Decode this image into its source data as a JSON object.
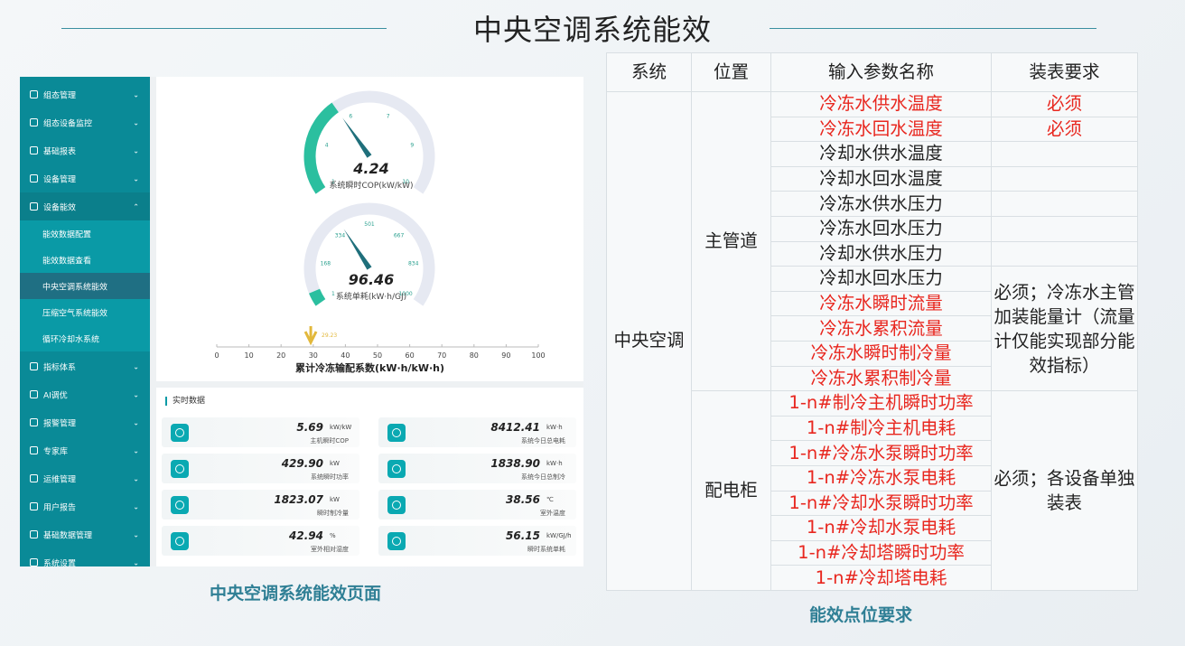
{
  "title": "中央空调系统能效",
  "captions": {
    "left": "中央空调系统能效页面",
    "right": "能效点位要求"
  },
  "sidebar": {
    "items": [
      "组态管理",
      "组态设备监控",
      "基础报表",
      "设备管理",
      "设备能效"
    ],
    "sub_items": [
      "能效数据配置",
      "能效数据查看",
      "中央空调系统能效",
      "压缩空气系统能效",
      "循环冷却水系统"
    ],
    "items_after": [
      "指标体系",
      "AI调优",
      "报警管理",
      "专家库",
      "运维管理",
      "用户报告",
      "基础数据管理",
      "系统设置"
    ]
  },
  "gauges": [
    {
      "value": "4.24",
      "numeric": 4.24,
      "min": 1,
      "max": 10,
      "label": "系统瞬时COP(kW/kW)",
      "ticks": [
        "1",
        "4",
        "6",
        "7",
        "9",
        "10"
      ],
      "color": "#2bbf9f"
    },
    {
      "value": "96.46",
      "numeric": 96.46,
      "min": 1,
      "max": 1000,
      "label": "系统单耗(kW·h/GJ)",
      "ticks": [
        "1",
        "168",
        "334",
        "501",
        "667",
        "834",
        "1000"
      ],
      "color": "#2bbf9f"
    }
  ],
  "bar": {
    "title": "累计冷冻输配系数(kW·h/kW·h)",
    "marker": "29.23",
    "marker_value": 29.23,
    "ticks": [
      "0",
      "10",
      "20",
      "30",
      "40",
      "50",
      "60",
      "70",
      "80",
      "90",
      "100"
    ]
  },
  "realtime": {
    "title": "实时数据",
    "tiles": [
      {
        "value": "5.69",
        "unit": "kW/kW",
        "label": "主机瞬时COP"
      },
      {
        "value": "8412.41",
        "unit": "kW·h",
        "label": "系统今日总电耗"
      },
      {
        "value": "429.90",
        "unit": "kW",
        "label": "系统瞬时功率"
      },
      {
        "value": "1838.90",
        "unit": "kW·h",
        "label": "系统今日总制冷"
      },
      {
        "value": "1823.07",
        "unit": "kW",
        "label": "瞬时制冷量"
      },
      {
        "value": "38.56",
        "unit": "℃",
        "label": "室外温度"
      },
      {
        "value": "42.94",
        "unit": "%",
        "label": "室外相对湿度"
      },
      {
        "value": "56.15",
        "unit": "kW/GJ/h",
        "label": "瞬时系统单耗"
      }
    ]
  },
  "table": {
    "headers": [
      "系统",
      "位置",
      "输入参数名称",
      "装表要求"
    ],
    "system": "中央空调",
    "locations": [
      "主管道",
      "配电柜"
    ],
    "params": [
      {
        "name": "冷冻水供水温度",
        "req": "必须",
        "red": true
      },
      {
        "name": "冷冻水回水温度",
        "req": "必须",
        "red": true
      },
      {
        "name": "冷却水供水温度",
        "req": "",
        "red": false
      },
      {
        "name": "冷却水回水温度",
        "req": "",
        "red": false
      },
      {
        "name": "冷冻水供水压力",
        "req": "",
        "red": false
      },
      {
        "name": "冷冻水回水压力",
        "req": "",
        "red": false
      },
      {
        "name": "冷却水供水压力",
        "req": "",
        "red": false
      },
      {
        "name": "冷却水回水压力",
        "red": false
      },
      {
        "name": "冷冻水瞬时流量",
        "red": true
      },
      {
        "name": "冷冻水累积流量",
        "red": true
      },
      {
        "name": "冷冻水瞬时制冷量",
        "red": true
      },
      {
        "name": "冷冻水累积制冷量",
        "red": true
      },
      {
        "name": "1-n#制冷主机瞬时功率",
        "red": true
      },
      {
        "name": "1-n#制冷主机电耗",
        "red": true
      },
      {
        "name": "1-n#冷冻水泵瞬时功率",
        "red": true
      },
      {
        "name": "1-n#冷冻水泵电耗",
        "red": true
      },
      {
        "name": "1-n#冷却水泵瞬时功率",
        "red": true
      },
      {
        "name": "1-n#冷却水泵电耗",
        "red": true
      },
      {
        "name": "1-n#冷却塔瞬时功率",
        "red": true
      },
      {
        "name": "1-n#冷却塔电耗",
        "red": true
      }
    ],
    "merged_req_1": "必须；冷冻水主管加装能量计（流量计仅能实现部分能效指标）",
    "merged_req_2": "必须；各设备单独装表"
  },
  "colors": {
    "accent": "#0a8a97",
    "red": "#e8271f",
    "gauge_bg": "#e6e9f2",
    "caption": "#2f7f95"
  }
}
